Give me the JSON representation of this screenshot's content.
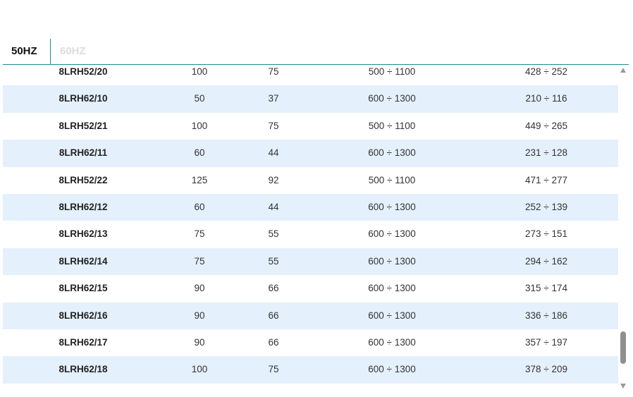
{
  "tabs": {
    "hz50": "50HZ",
    "hz60": "60HZ",
    "active": "50HZ"
  },
  "table": {
    "rows": [
      {
        "model": "8LRH52/20",
        "kw": "100",
        "hp": "75",
        "flow": "500 ÷ 1100",
        "head": "428 ÷ 252"
      },
      {
        "model": "8LRH62/10",
        "kw": "50",
        "hp": "37",
        "flow": "600 ÷ 1300",
        "head": "210 ÷ 116"
      },
      {
        "model": "8LRH52/21",
        "kw": "100",
        "hp": "75",
        "flow": "500 ÷ 1100",
        "head": "449 ÷ 265"
      },
      {
        "model": "8LRH62/11",
        "kw": "60",
        "hp": "44",
        "flow": "600 ÷ 1300",
        "head": "231 ÷ 128"
      },
      {
        "model": "8LRH52/22",
        "kw": "125",
        "hp": "92",
        "flow": "500 ÷ 1100",
        "head": "471 ÷ 277"
      },
      {
        "model": "8LRH62/12",
        "kw": "60",
        "hp": "44",
        "flow": "600 ÷ 1300",
        "head": "252 ÷ 139"
      },
      {
        "model": "8LRH62/13",
        "kw": "75",
        "hp": "55",
        "flow": "600 ÷ 1300",
        "head": "273 ÷ 151"
      },
      {
        "model": "8LRH62/14",
        "kw": "75",
        "hp": "55",
        "flow": "600 ÷ 1300",
        "head": "294 ÷ 162"
      },
      {
        "model": "8LRH62/15",
        "kw": "90",
        "hp": "66",
        "flow": "600 ÷ 1300",
        "head": "315 ÷ 174"
      },
      {
        "model": "8LRH62/16",
        "kw": "90",
        "hp": "66",
        "flow": "600 ÷ 1300",
        "head": "336 ÷ 186"
      },
      {
        "model": "8LRH62/17",
        "kw": "90",
        "hp": "66",
        "flow": "600 ÷ 1300",
        "head": "357 ÷ 197"
      },
      {
        "model": "8LRH62/18",
        "kw": "100",
        "hp": "75",
        "flow": "600 ÷ 1300",
        "head": "378 ÷ 209"
      }
    ]
  },
  "colors": {
    "accent": "#1f8a96",
    "row_alt": "#e4f0fc",
    "inactive_tab": "#dcdcdc"
  },
  "scrollbar": {
    "position_fraction": 0.9,
    "icons": {
      "up": "arrow-up-icon",
      "down": "arrow-down-icon"
    }
  }
}
